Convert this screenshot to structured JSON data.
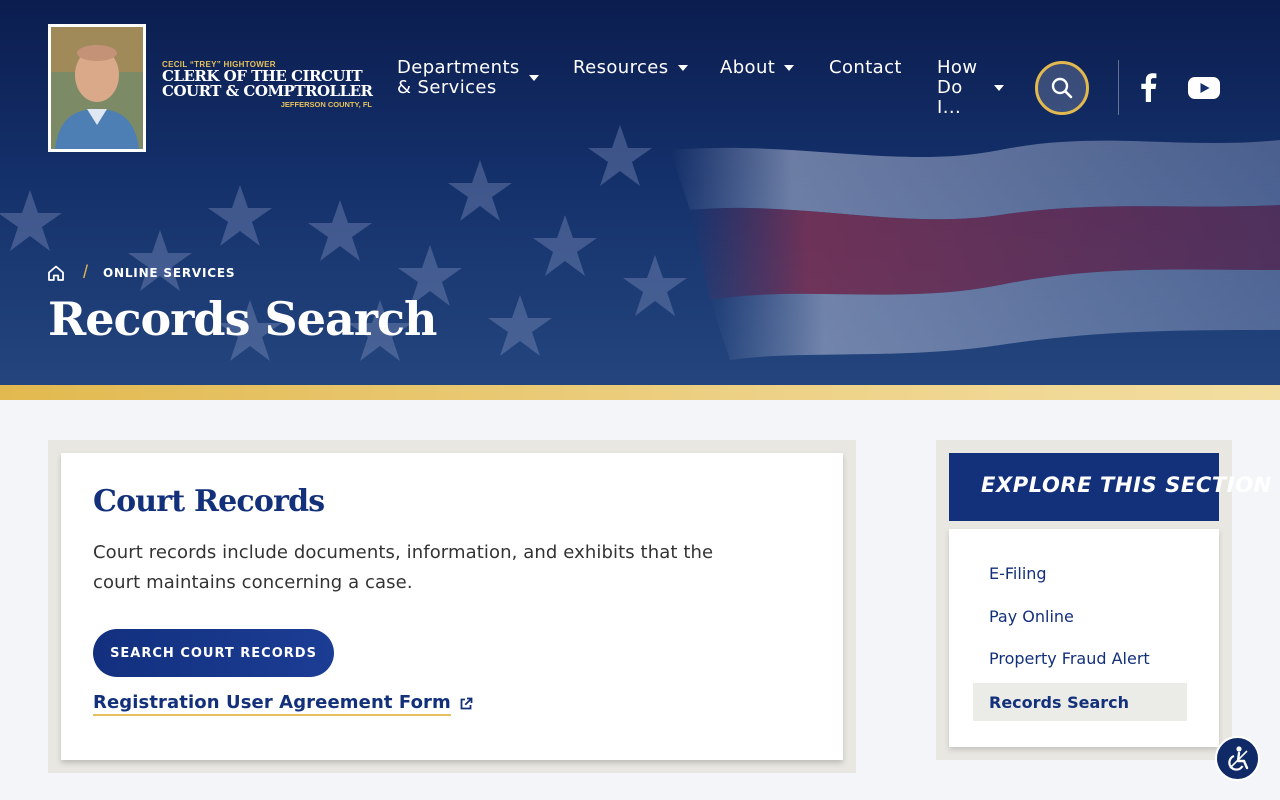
{
  "header": {
    "logo": {
      "small_line": "CECIL “TREY” HIGHTOWER",
      "line1": "CLERK OF THE CIRCUIT",
      "line2": "COURT & COMPTROLLER",
      "county": "JEFFERSON COUNTY, FL"
    },
    "nav": [
      {
        "label_line1": "Departments",
        "label_line2": "& Services"
      },
      {
        "label": "Resources"
      },
      {
        "label": "About"
      },
      {
        "label": "Contact"
      },
      {
        "label_line1": "How",
        "label_line2": "Do",
        "label_line3": "I..."
      }
    ],
    "icons": {
      "search": "search-icon",
      "facebook": "facebook-icon",
      "youtube": "youtube-icon"
    }
  },
  "hero": {
    "breadcrumb": {
      "home_icon": "home-icon",
      "current": "ONLINE SERVICES"
    },
    "title": "Records Search"
  },
  "main": {
    "card_title": "Court Records",
    "card_text": "Court records include documents, information, and exhibits that the court maintains concerning a case.",
    "cta_label": "SEARCH COURT RECORDS",
    "link_label": "Registration User Agreement Form"
  },
  "sidebar": {
    "heading": "EXPLORE THIS SECTION",
    "items": [
      {
        "label": "E-Filing"
      },
      {
        "label": "Pay Online"
      },
      {
        "label": "Property Fraud Alert"
      },
      {
        "label": "Records Search"
      }
    ]
  },
  "colors": {
    "navy": "#13307a",
    "gold": "#e2b94f",
    "background": "#f3f5f9"
  }
}
